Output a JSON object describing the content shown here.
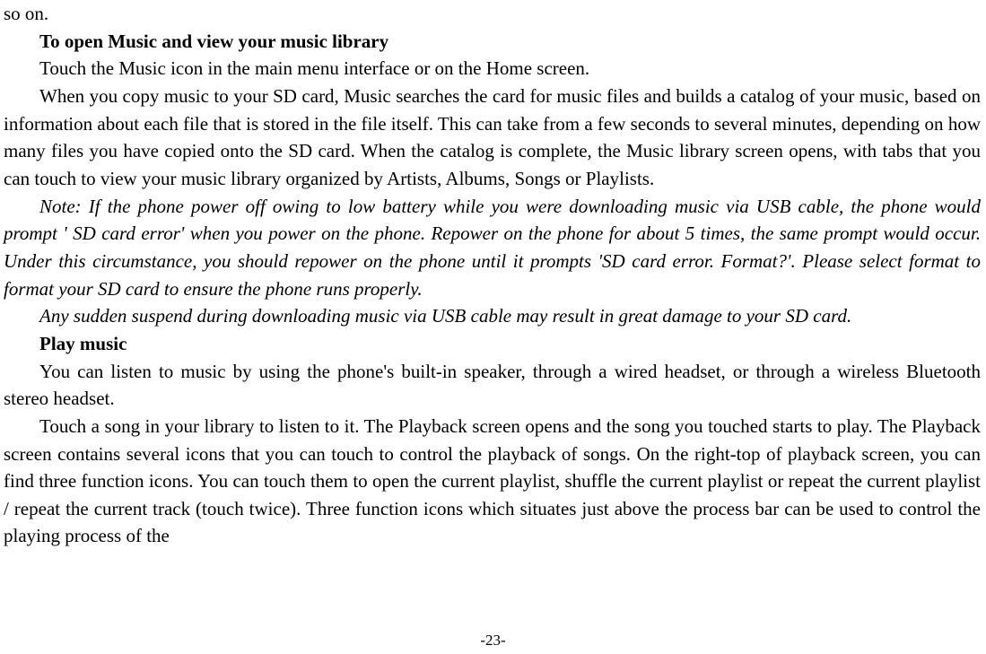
{
  "frag0": "so on.",
  "h1": "To open Music and view your music library",
  "p1": "Touch the Music icon in the main menu interface or on the Home screen.",
  "p2": "When you copy music to your SD card, Music searches the card for music files and builds a catalog of your music, based on information about each file that is stored in the file itself. This can take from a few seconds to several minutes, depending on how many files you have copied onto the SD card. When the catalog is complete, the Music library screen opens, with tabs that you can touch to view your music library organized by Artists, Albums, Songs or Playlists.",
  "n1": "Note: If the phone power off owing to low battery while you were downloading music via USB cable, the phone would prompt ' SD card error' when you power on the phone. Repower on the phone for about 5 times, the same prompt would occur. Under this circumstance, you should repower on the phone until it prompts 'SD card error. Format?'. Please select format to format your SD card to ensure the phone runs properly.",
  "n2": "Any sudden suspend during downloading music via USB cable may result in great damage to your SD card.",
  "h2": "Play music",
  "p3": "You can listen to music by using the phone's built-in speaker, through a wired headset, or through a wireless Bluetooth stereo headset.",
  "p4": "Touch a song in your library to listen to it. The Playback screen opens and the song you touched starts to play. The Playback screen contains several icons that you can touch to control the playback of songs. On the right-top of playback screen, you can find three function icons. You can touch them to open the current playlist, shuffle the current playlist or repeat the current playlist / repeat the current track (touch twice). Three function icons which situates just above the process bar can be used to control the playing process of the",
  "footer": "-23-"
}
